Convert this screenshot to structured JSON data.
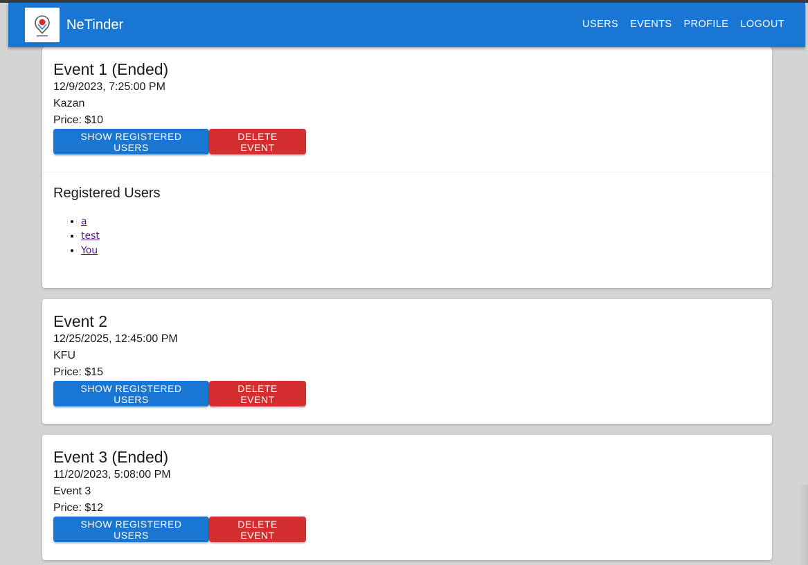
{
  "app": {
    "title": "NeTinder",
    "logo_icon": "netinder-logo-icon",
    "accent_color": "#1976d2",
    "danger_color": "#d32f2f"
  },
  "nav": {
    "users": "USERS",
    "events": "EVENTS",
    "profile": "PROFILE",
    "logout": "LOGOUT"
  },
  "events": [
    {
      "title": "Event 1 (Ended)",
      "datetime": "12/9/2023, 7:25:00 PM",
      "location": "Kazan",
      "price": "Price: $10",
      "show_users_label": "SHOW REGISTERED USERS",
      "delete_label": "DELETE EVENT",
      "registered_users_title": "Registered Users",
      "registered_users": [
        "a",
        "test",
        "You"
      ]
    },
    {
      "title": "Event 2",
      "datetime": "12/25/2025, 12:45:00 PM",
      "location": "KFU",
      "price": "Price: $15",
      "show_users_label": "SHOW REGISTERED USERS",
      "delete_label": "DELETE EVENT"
    },
    {
      "title": "Event 3 (Ended)",
      "datetime": "11/20/2023, 5:08:00 PM",
      "location": "Event 3",
      "price": "Price: $12",
      "show_users_label": "SHOW REGISTERED USERS",
      "delete_label": "DELETE EVENT"
    }
  ]
}
